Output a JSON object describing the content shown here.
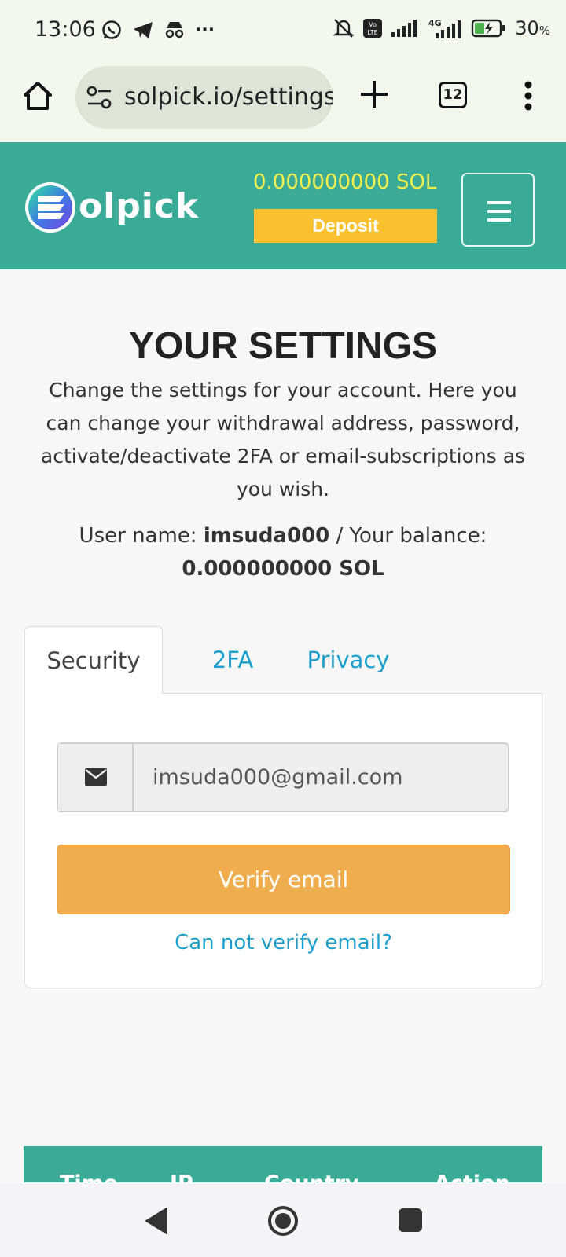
{
  "status_bar": {
    "time": "13:06",
    "battery": "30",
    "battery_unit": "%",
    "network": "4G",
    "volte": "Vo LTE",
    "more": "···"
  },
  "browser": {
    "url": "solpick.io/settings",
    "tab_count": "12"
  },
  "header": {
    "brand": "olpick",
    "balance": "0.000000000 SOL",
    "deposit_label": "Deposit"
  },
  "page": {
    "title": "YOUR SETTINGS",
    "description": "Change the settings for your account. Here you can change your withdrawal address, password, activate/deactivate 2FA or email-subscriptions as you wish.",
    "user_label": "User name:",
    "username": "imsuda000",
    "balance_label": " / Your balance:",
    "balance_value": "0.000000000 SOL"
  },
  "tabs": [
    {
      "label": "Security",
      "active": true
    },
    {
      "label": "2FA",
      "active": false
    },
    {
      "label": "Privacy",
      "active": false
    }
  ],
  "security": {
    "email_value": "imsuda000@gmail.com",
    "verify_label": "Verify email",
    "cannot_verify_label": "Can not verify email?"
  },
  "sessions_table": {
    "columns": [
      "Time",
      "IP",
      "Country",
      "Action"
    ]
  },
  "colors": {
    "brand_teal": "#39ab97",
    "balance_yellow": "#f4ef4a",
    "deposit_yellow": "#fbc02d",
    "verify_orange": "#efad4e",
    "link_blue": "#1c9fcd"
  }
}
